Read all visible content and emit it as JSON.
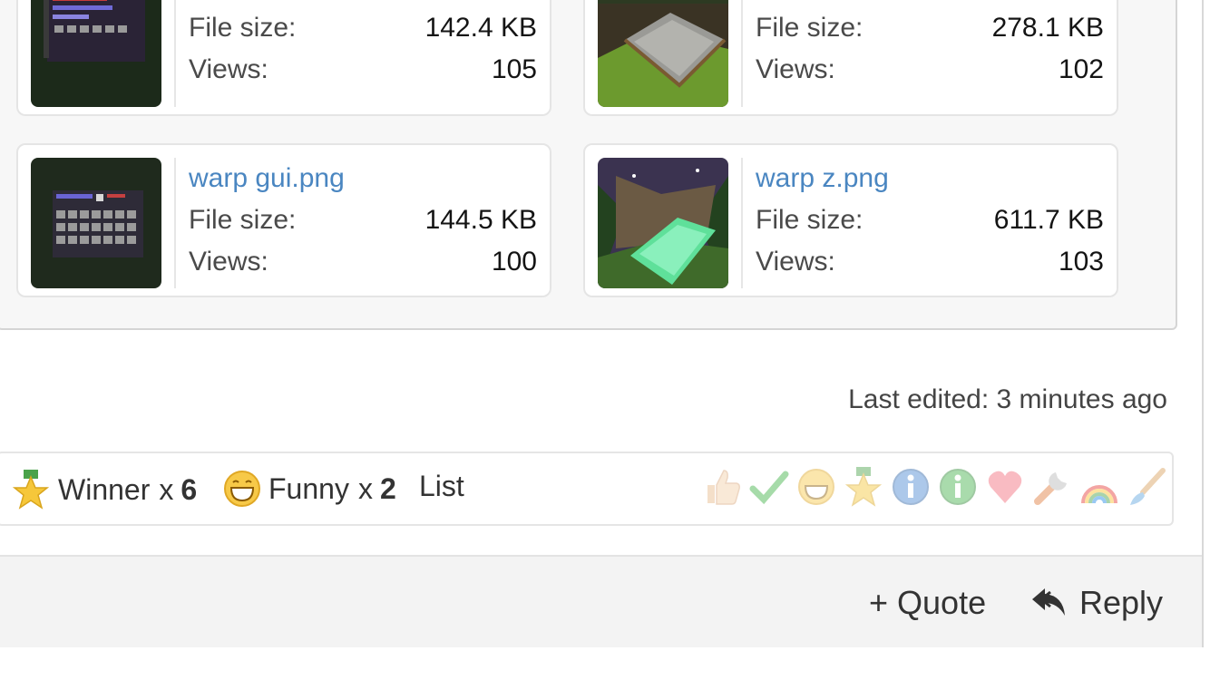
{
  "attachments": [
    {
      "name": "",
      "file_size_label": "File size:",
      "file_size": "142.4 KB",
      "views_label": "Views:",
      "views": "105"
    },
    {
      "name": "",
      "file_size_label": "File size:",
      "file_size": "278.1 KB",
      "views_label": "Views:",
      "views": "102"
    },
    {
      "name": "warp gui.png",
      "file_size_label": "File size:",
      "file_size": "144.5 KB",
      "views_label": "Views:",
      "views": "100"
    },
    {
      "name": "warp z.png",
      "file_size_label": "File size:",
      "file_size": "611.7 KB",
      "views_label": "Views:",
      "views": "103"
    }
  ],
  "last_edited": "Last edited: 3 minutes ago",
  "reactions": {
    "summary": [
      {
        "icon": "winner-medal-icon",
        "label": "Winner",
        "times": "x",
        "count": "6"
      },
      {
        "icon": "funny-smiley-icon",
        "label": "Funny",
        "times": "x",
        "count": "2"
      }
    ],
    "list_label": "List",
    "options": [
      "like-thumb-icon",
      "agree-check-icon",
      "funny-smiley-icon",
      "winner-medal-icon",
      "informative-icon",
      "useful-icon",
      "love-heart-icon",
      "helpful-wrench-icon",
      "creative-rainbow-icon",
      "artistic-brush-icon"
    ]
  },
  "footer": {
    "quote_label": "+ Quote",
    "reply_label": "Reply"
  },
  "colors": {
    "link": "#4a86c1",
    "footer_bg": "#f3f3f3",
    "border": "#e5e5e5"
  }
}
